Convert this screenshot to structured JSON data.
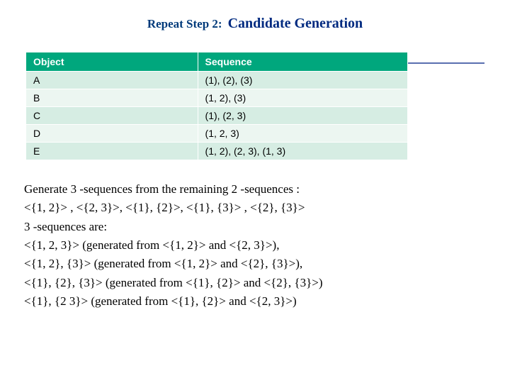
{
  "title": {
    "left": "Repeat Step 2:",
    "right": "Candidate Generation"
  },
  "table": {
    "headers": [
      "Object",
      "Sequence"
    ],
    "rows": [
      {
        "obj": "A",
        "seq": "(1), (2), (3)"
      },
      {
        "obj": "B",
        "seq": "(1, 2), (3)"
      },
      {
        "obj": "C",
        "seq": "(1), (2, 3)"
      },
      {
        "obj": "D",
        "seq": "(1, 2, 3)"
      },
      {
        "obj": "E",
        "seq": "(1, 2), (2, 3), (1, 3)"
      }
    ]
  },
  "paragraph": {
    "l1": "Generate 3 -sequences from the remaining 2 -sequences :",
    "l2": "<{1, 2}> , <{2, 3}>, <{1}, {2}>, <{1}, {3}> , <{2}, {3}>",
    "l3": "3 -sequences are:",
    "l4": "<{1, 2, 3}>  (generated from <{1, 2}> and <{2, 3}>),",
    "l5": "<{1, 2}, {3}>  (generated from <{1, 2}> and <{2}, {3}>),",
    "l6": "<{1}, {2}, {3}>  (generated from <{1}, {2}> and <{2}, {3}>)",
    "l7": "<{1}, {2 3}>  (generated from <{1}, {2}> and <{2, 3}>)"
  }
}
